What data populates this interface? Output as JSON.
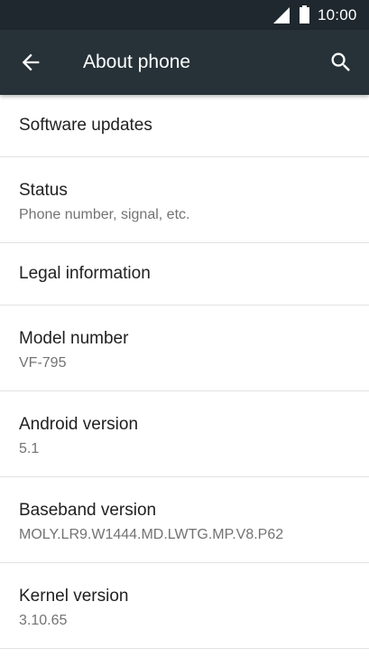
{
  "status_bar": {
    "time": "10:00",
    "icons": [
      "signal-icon",
      "battery-icon"
    ]
  },
  "app_bar": {
    "back_icon": "arrow-left-icon",
    "title": "About phone",
    "search_icon": "search-icon"
  },
  "items": [
    {
      "label": "Software updates"
    },
    {
      "label": "Status",
      "summary": "Phone number, signal, etc."
    },
    {
      "label": "Legal information"
    },
    {
      "label": "Model number",
      "summary": "VF-795"
    },
    {
      "label": "Android version",
      "summary": "5.1"
    },
    {
      "label": "Baseband version",
      "summary": "MOLY.LR9.W1444.MD.LWTG.MP.V8.P62"
    },
    {
      "label": "Kernel version",
      "summary": "3.10.65"
    }
  ],
  "colors": {
    "status_bar": "#1f282e",
    "app_bar": "#263238",
    "divider": "#e2e2e2",
    "primary_text": "#212121",
    "secondary_text": "#737373"
  }
}
